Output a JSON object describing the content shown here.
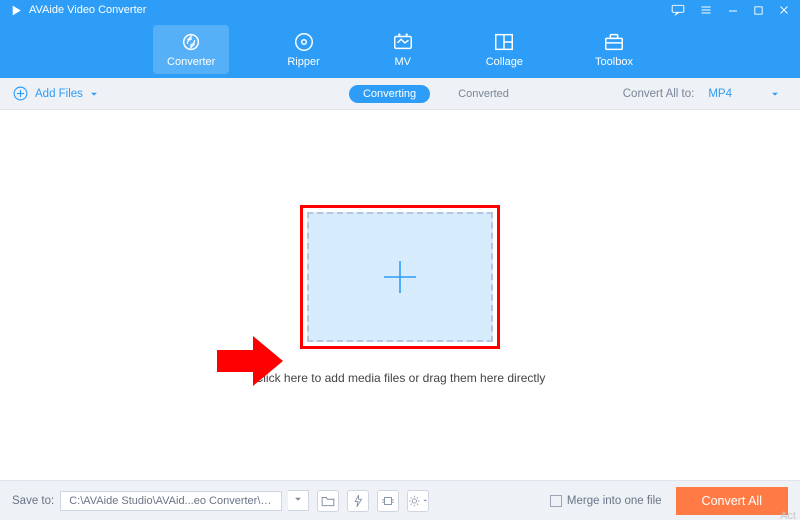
{
  "title": "AVAide Video Converter",
  "nav": {
    "items": [
      {
        "label": "Converter"
      },
      {
        "label": "Ripper"
      },
      {
        "label": "MV"
      },
      {
        "label": "Collage"
      },
      {
        "label": "Toolbox"
      }
    ]
  },
  "toolbar": {
    "add_files": "Add Files",
    "tabs": {
      "converting": "Converting",
      "converted": "Converted"
    },
    "convert_all_to_label": "Convert All to:",
    "convert_all_to_value": "MP4"
  },
  "main": {
    "hint": "Click here to add media files or drag them here directly"
  },
  "footer": {
    "save_to_label": "Save to:",
    "save_path": "C:\\AVAide Studio\\AVAid...eo Converter\\Converted",
    "merge_label": "Merge into one file",
    "convert_all": "Convert All"
  },
  "watermark": "Act"
}
